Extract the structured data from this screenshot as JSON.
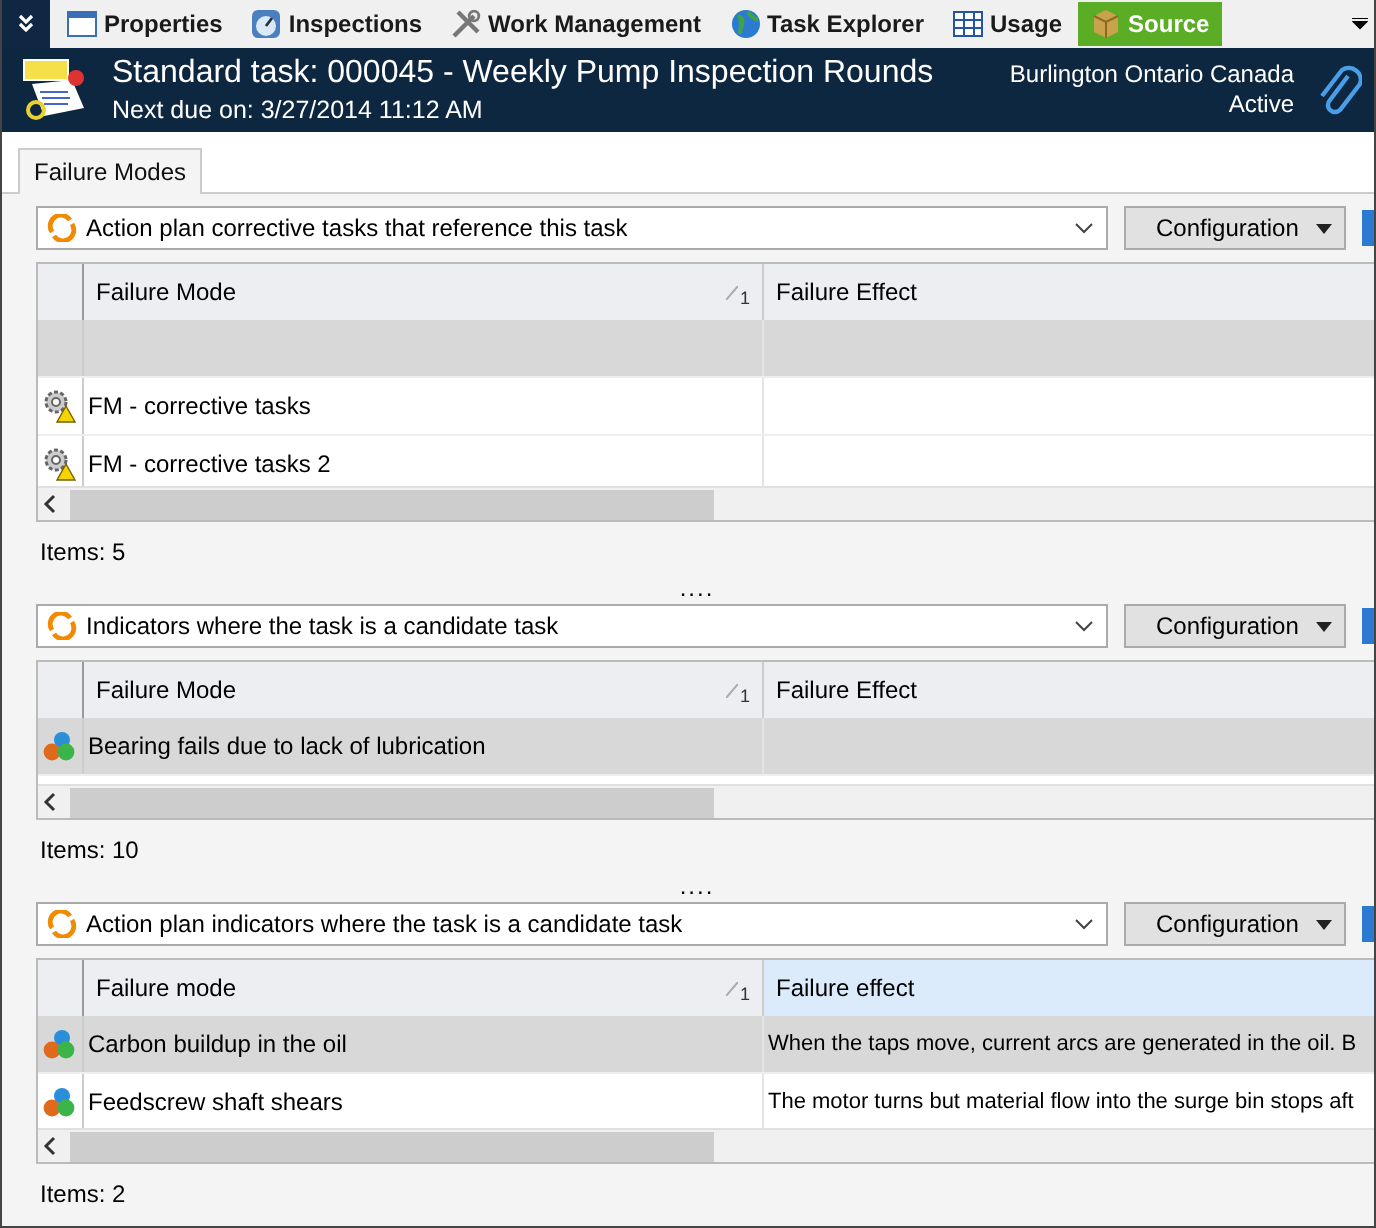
{
  "toolbar": {
    "items": [
      {
        "label": "Properties",
        "kind": "window",
        "selected": false
      },
      {
        "label": "Inspections",
        "kind": "gauge",
        "selected": false
      },
      {
        "label": "Work Management",
        "kind": "tools",
        "selected": false
      },
      {
        "label": "Task Explorer",
        "kind": "globe",
        "selected": false
      },
      {
        "label": "Usage",
        "kind": "grid",
        "selected": false
      },
      {
        "label": "Source",
        "kind": "box",
        "selected": true
      }
    ]
  },
  "header": {
    "title": "Standard task: 000045 - Weekly Pump Inspection Rounds",
    "subtitle": "Next due on: 3/27/2014 11:12 AM",
    "location": "Burlington Ontario Canada",
    "status": "Active"
  },
  "tabs": [
    {
      "label": "Failure Modes",
      "selected": true
    }
  ],
  "sections": [
    {
      "query": "Action plan corrective tasks that reference this task",
      "button": "Configuration",
      "columns": [
        {
          "label": "Failure Mode",
          "sort": "1",
          "highlighted": false
        },
        {
          "label": "Failure Effect",
          "highlighted": false
        }
      ],
      "rows": [
        {
          "kind": "blank",
          "selected": true
        },
        {
          "kind": "task",
          "cells": [
            "FM - corrective tasks"
          ],
          "selected": false
        },
        {
          "kind": "task",
          "cells": [
            "FM - corrective tasks 2"
          ],
          "selected": false
        }
      ],
      "count": "Items: 5",
      "splitter": "...."
    },
    {
      "query": "Indicators where the task is a candidate task",
      "button": "Configuration",
      "columns": [
        {
          "label": "Failure Mode",
          "sort": "1",
          "highlighted": false
        },
        {
          "label": "Failure Effect",
          "highlighted": false
        }
      ],
      "rows": [
        {
          "kind": "indicator",
          "cells": [
            "Bearing fails due to lack of lubrication"
          ],
          "selected": true
        }
      ],
      "count": "Items: 10",
      "splitter": "...."
    },
    {
      "query": "Action plan indicators where the task is a candidate task",
      "button": "Configuration",
      "columns": [
        {
          "label": "Failure mode",
          "sort": "1",
          "highlighted": false
        },
        {
          "label": "Failure effect",
          "highlighted": true
        }
      ],
      "rows": [
        {
          "kind": "indicator",
          "cells": [
            "Carbon buildup in the oil",
            "When the taps move, current arcs are generated in the oil. B"
          ],
          "selected": true
        },
        {
          "kind": "indicator",
          "cells": [
            "Feedscrew shaft shears",
            "The motor turns but material flow into the surge bin stops aft"
          ],
          "selected": false
        }
      ],
      "count": "Items: 2"
    }
  ]
}
